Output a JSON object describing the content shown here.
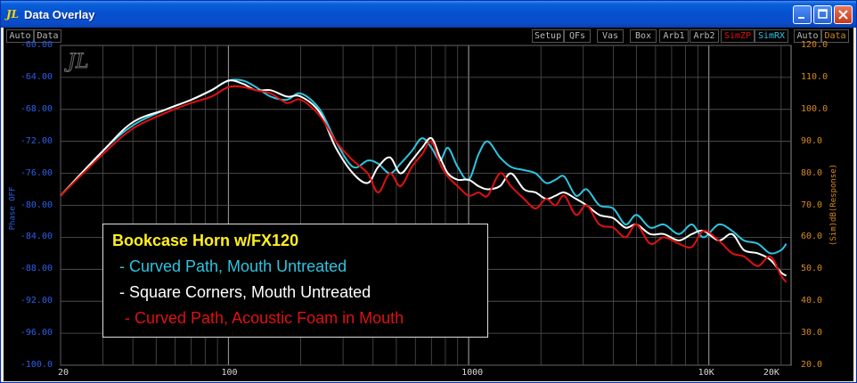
{
  "window": {
    "title": "Data Overlay",
    "icon": "soundeasy-logo-icon"
  },
  "toolbar": {
    "left": [
      "Auto",
      "Data"
    ],
    "right_tools": [
      "Setup",
      "QFs",
      "Vas",
      "Box",
      "Arb1",
      "Arb2",
      "SimZP",
      "SimRX"
    ],
    "right_axis": [
      "Auto",
      "Data"
    ],
    "colors": {
      "SimZP": "#e01010",
      "SimRX": "#2ec4e0",
      "Data_right": "#d68a1c",
      "default": "#bbbbbb"
    }
  },
  "chart_data": {
    "type": "line",
    "xscale": "log",
    "xlim": [
      20,
      22000
    ],
    "x_ticks": [
      "20",
      "100",
      "1000",
      "10K",
      "20K"
    ],
    "left_axis": {
      "label": "Phase OFF",
      "ylim": [
        -100,
        -60
      ],
      "ticks": [
        "-60.00",
        "-64.00",
        "-68.00",
        "-72.00",
        "-76.00",
        "-80.00",
        "-84.00",
        "-88.00",
        "-92.00",
        "-96.00",
        "-100.0"
      ]
    },
    "right_axis": {
      "label": "(Sim)dB(Response)",
      "ylim": [
        20,
        120
      ],
      "ticks": [
        "120.0",
        "110.0",
        "100.0",
        "90.0",
        "80.0",
        "70.0",
        "60.0",
        "50.0",
        "40.0",
        "30.0",
        "20.0"
      ]
    },
    "grid": true,
    "series": [
      {
        "name": "Curved Path, Mouth Untreated",
        "color": "#2ec4e0",
        "x": [
          20,
          30,
          40,
          55,
          70,
          85,
          100,
          115,
          130,
          150,
          175,
          200,
          240,
          280,
          330,
          380,
          420,
          470,
          520,
          580,
          640,
          700,
          760,
          820,
          900,
          1000,
          1100,
          1200,
          1350,
          1500,
          1700,
          1900,
          2100,
          2300,
          2500,
          2800,
          3100,
          3500,
          4000,
          4500,
          5000,
          5700,
          6500,
          7500,
          8500,
          9500,
          11000,
          12500,
          14000,
          16000,
          18000,
          20000,
          21000
        ],
        "values": [
          73,
          87,
          95,
          100,
          103,
          106,
          109,
          109,
          107,
          104,
          103,
          105,
          100,
          90,
          82,
          84,
          83,
          80,
          83,
          87,
          91,
          88,
          84,
          88,
          82,
          78,
          86,
          90,
          85,
          82,
          81,
          80,
          77,
          78,
          79,
          73,
          75,
          70,
          69,
          64,
          67,
          63,
          64,
          61,
          64,
          60,
          64,
          62,
          59,
          58,
          55,
          56,
          58
        ]
      },
      {
        "name": "Square Corners, Mouth Untreated",
        "color": "#ffffff",
        "x": [
          20,
          30,
          40,
          55,
          70,
          85,
          100,
          115,
          130,
          150,
          175,
          200,
          240,
          280,
          330,
          380,
          420,
          470,
          520,
          580,
          640,
          700,
          760,
          820,
          900,
          1000,
          1100,
          1200,
          1350,
          1500,
          1700,
          1900,
          2100,
          2300,
          2500,
          2800,
          3100,
          3500,
          4000,
          4500,
          5000,
          5700,
          6500,
          7500,
          8500,
          9500,
          11000,
          12500,
          14000,
          16000,
          18000,
          20000,
          21000
        ],
        "values": [
          73,
          87,
          96,
          100,
          103,
          106,
          109,
          108,
          106,
          106,
          104,
          104,
          99,
          88,
          80,
          77,
          82,
          85,
          80,
          84,
          88,
          91,
          85,
          80,
          78,
          78,
          76,
          75,
          76,
          80,
          75,
          74,
          72,
          73,
          74,
          72,
          70,
          67,
          66,
          63,
          64,
          61,
          61,
          59,
          61,
          62,
          59,
          61,
          56,
          55,
          53,
          49,
          48
        ]
      },
      {
        "name": "Curved Path, Acoustic Foam in Mouth",
        "color": "#e01010",
        "x": [
          20,
          30,
          40,
          55,
          70,
          85,
          100,
          115,
          130,
          150,
          175,
          200,
          240,
          280,
          330,
          380,
          420,
          470,
          520,
          580,
          640,
          700,
          760,
          820,
          900,
          1000,
          1100,
          1200,
          1350,
          1500,
          1700,
          1900,
          2100,
          2300,
          2500,
          2800,
          3100,
          3500,
          4000,
          4500,
          5000,
          5700,
          6500,
          7500,
          8500,
          9500,
          11000,
          12500,
          14000,
          16000,
          18000,
          20000,
          21000
        ],
        "values": [
          73,
          86,
          94,
          99,
          102,
          104,
          107,
          107,
          106,
          105,
          102,
          103,
          98,
          90,
          84,
          80,
          74,
          80,
          76,
          82,
          86,
          90,
          83,
          79,
          76,
          73,
          74,
          73,
          80,
          76,
          72,
          69,
          72,
          70,
          73,
          67,
          70,
          64,
          63,
          60,
          64,
          58,
          60,
          58,
          57,
          62,
          59,
          55,
          54,
          51,
          54,
          48,
          46
        ]
      }
    ]
  },
  "legend": {
    "title": "Bookcase Horn w/FX120",
    "lines": [
      "- Curved Path, Mouth Untreated",
      "- Square Corners, Mouth Untreated",
      "- Curved Path, Acoustic Foam in Mouth"
    ]
  },
  "watermark": "JL"
}
